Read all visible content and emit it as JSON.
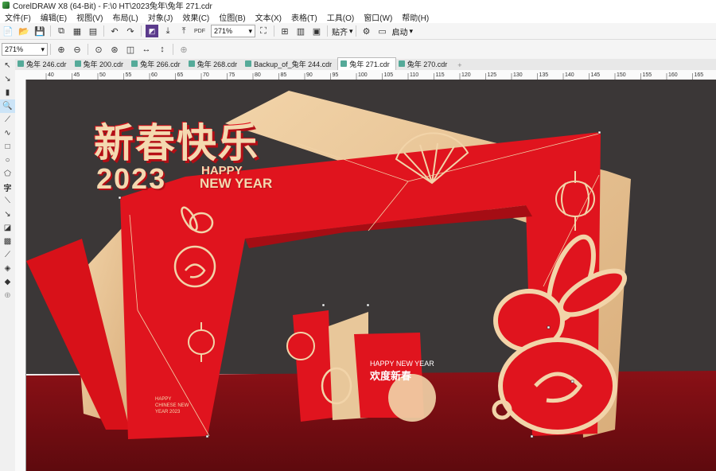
{
  "window": {
    "title": "CorelDRAW X8 (64-Bit) - F:\\0 HT\\2023兔年\\兔年 271.cdr"
  },
  "menu": [
    "文件(F)",
    "编辑(E)",
    "视图(V)",
    "布局(L)",
    "对象(J)",
    "效果(C)",
    "位图(B)",
    "文本(X)",
    "表格(T)",
    "工具(O)",
    "窗口(W)",
    "帮助(H)"
  ],
  "toolbar1": {
    "zoom": "271%",
    "snap_label": "贴齐",
    "launch_label": "启动"
  },
  "toolbar2": {
    "zoom": "271%"
  },
  "tabs": [
    "兔年 246.cdr",
    "兔年 200.cdr",
    "兔年 266.cdr",
    "兔年 268.cdr",
    "Backup_of_兔年 244.cdr",
    "兔年 271.cdr",
    "兔年 270.cdr"
  ],
  "active_tab": "兔年 271.cdr",
  "ruler_ticks": [
    "40",
    "45",
    "50",
    "55",
    "60",
    "65",
    "70",
    "75",
    "80",
    "85",
    "90",
    "95",
    "100",
    "105",
    "110",
    "115",
    "120",
    "125",
    "130",
    "135",
    "140",
    "145",
    "150",
    "155",
    "160",
    "165"
  ],
  "design": {
    "title_cn": "新春快乐",
    "year": "2023",
    "happy": "HAPPY",
    "new_year": "NEW YEAR",
    "small_happy": "HAPPY NEW YEAR",
    "small_cn": "欢度新春",
    "pillar_text_1": "HAPPY",
    "pillar_text_2": "CHINESE NEW",
    "pillar_text_3": "YEAR 2023"
  },
  "colors": {
    "red": "#e0141e",
    "gold": "#e8c79a",
    "dark_bg": "#3b3737",
    "floor": "#7a0d12"
  }
}
